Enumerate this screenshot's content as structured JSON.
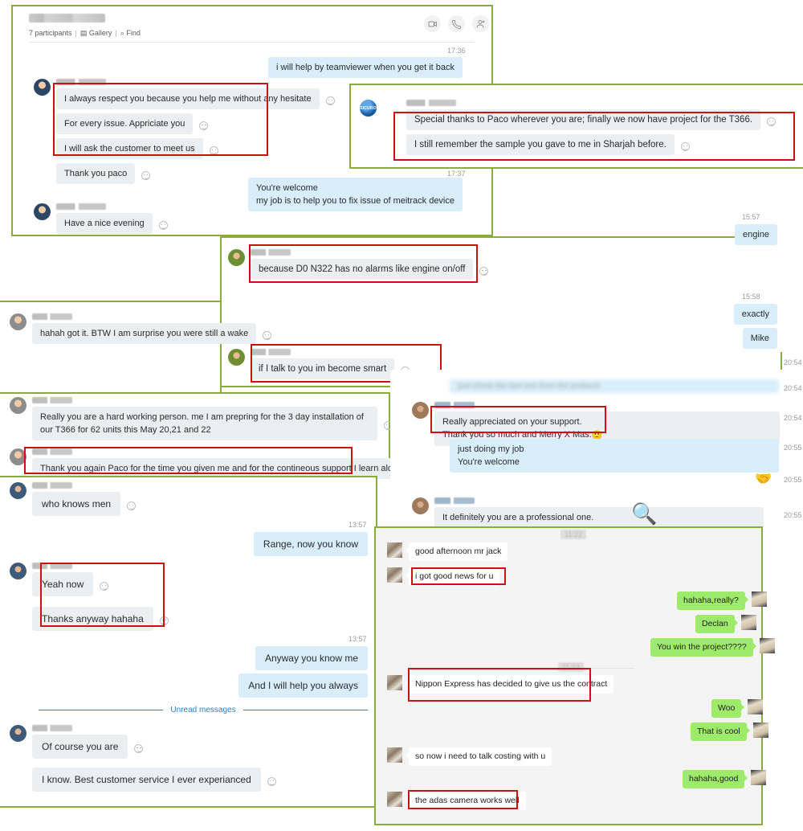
{
  "header": {
    "title_redacted": "",
    "participants": "7 participants",
    "gallery": "Gallery",
    "find": "Find",
    "icons": [
      "video-call-icon",
      "voice-call-icon",
      "add-people-icon"
    ]
  },
  "colors": {
    "panel_border_green": "#8aad39",
    "highlight_red": "#cc1111",
    "incoming_bubble": "#eceff1",
    "outgoing_bubble": "#d9eefb",
    "wechat_green_bubble": "#9eea6a",
    "unread_blue": "#2a7fc9"
  },
  "panel_top": {
    "out1": {
      "time": "17:36",
      "text": "i will help by teamviewer when you get it back"
    },
    "msg1": {
      "lines": [
        "I always respect you because you help me without any hesitate",
        "For every issue. Appriciate you",
        "I will ask the customer to meet us",
        "Thank you paco"
      ]
    },
    "out2": {
      "time": "17:37",
      "text": "You're welcome\nmy job is to help you to fix issue of meitrack device"
    },
    "msg2": {
      "text": "Have a nice evening"
    }
  },
  "panel_sicuro": {
    "avatar_label": "SICURO",
    "lines": [
      "Special thanks to Paco wherever you are; finally we now have project for the T366.",
      "I still remember the sample you gave to me in Sharjah before."
    ]
  },
  "panel_mid": {
    "msg1": {
      "text": "because D0 N322 has no alarms like engine on/off"
    },
    "msg2": {
      "text": "if I talk to you im become smart"
    }
  },
  "panel_right_short": {
    "t1": "15:57",
    "m1": "engine",
    "t2": "15:58",
    "m2": "exactly",
    "m3": "Mike"
  },
  "panel_left_mid": {
    "msg1": {
      "text": "hahah got it. BTW I am surprise you were still a wake"
    },
    "msg2": {
      "text": "Really you are a hard working person. me I am prepring for the 3 day installation of our T366 for 62 units this May 20,21 and 22"
    },
    "msg3": {
      "text": "Thank you again Paco for the time you given me and for the contineous support I learn alot"
    }
  },
  "panel_right_mid": {
    "cut_msg": {
      "time": "20:54",
      "text": ""
    },
    "msg1": {
      "time": "20:54",
      "text": "Really appreciated on your support.\nThank you so much and Merry X Mas."
    },
    "out1": {
      "time": "20:55",
      "text": "just doing my job\nYou're welcome"
    },
    "handshake": {
      "time": "20:55",
      "glyph": "handshake-emoji"
    },
    "msg2": {
      "time": "20:55",
      "text": "It definitely you are a professional one."
    },
    "top_time": "20:54"
  },
  "panel_bottom_left": {
    "msg_who": {
      "text": "who knows men"
    },
    "t1": "13:57",
    "out1": "Range, now you know",
    "msg_yeah": {
      "lines": [
        "Yeah now",
        "Thanks anyway hahaha"
      ]
    },
    "t2": "13:57",
    "out2": "Anyway you know me",
    "out3": "And I will help you always",
    "unread_label": "Unread messages",
    "msg_course": {
      "lines": [
        "Of course you are",
        "I know. Best customer service I ever experianced"
      ]
    }
  },
  "panel_wechat": {
    "date_top": "11:22",
    "date_mid": "11:23",
    "messages": [
      {
        "side": "them",
        "text": "good afternoon mr jack",
        "highlight": false
      },
      {
        "side": "them",
        "text": "i got good news for u",
        "highlight": true
      },
      {
        "side": "me",
        "text": "hahaha,really?",
        "highlight": false
      },
      {
        "side": "me",
        "text": "Declan",
        "highlight": false
      },
      {
        "side": "me",
        "text": "You win the project????",
        "highlight": false
      },
      {
        "side": "them",
        "text": "Nippon Express has decided to give us the contract",
        "highlight": true
      },
      {
        "side": "me",
        "text": "Woo",
        "highlight": false
      },
      {
        "side": "me",
        "text": "That is cool",
        "highlight": false
      },
      {
        "side": "them",
        "text": "so now i need to talk costing with u",
        "highlight": false
      },
      {
        "side": "me",
        "text": "hahaha,good",
        "highlight": false
      },
      {
        "side": "them",
        "text": "the adas camera works well",
        "highlight": true
      }
    ]
  }
}
